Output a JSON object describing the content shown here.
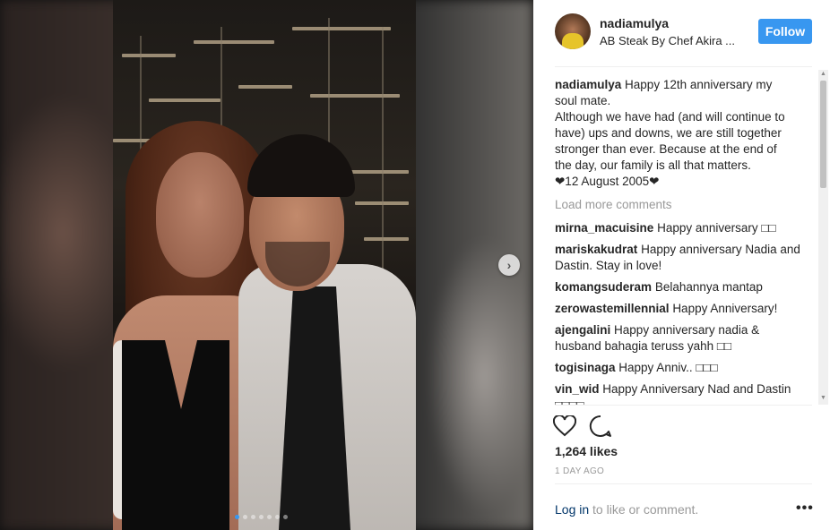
{
  "post": {
    "username": "nadiamulya",
    "location": "AB Steak By Chef Akira ...",
    "follow_label": "Follow",
    "caption_user": "nadiamulya",
    "caption_lines": [
      "Happy 12th anniversary my",
      "soul mate.",
      "Although we have had (and will continue to",
      "have) ups and downs, we are still together",
      "stronger than ever. Because at the end of",
      "the day, our family is all that matters.",
      "❤12 August 2005❤"
    ],
    "load_more": "Load more comments",
    "comments": [
      {
        "user": "mirna_macuisine",
        "text": "Happy anniversary □□"
      },
      {
        "user": "mariskakudrat",
        "text": "Happy anniversary Nadia and Dastin. Stay in love!"
      },
      {
        "user": "komangsuderam",
        "text": "Belahannya mantap"
      },
      {
        "user": "zerowastemillennial",
        "text": "Happy Anniversary!"
      },
      {
        "user": "ajengalini",
        "text": "Happy anniversary nadia & husband bahagia teruss yahh □□"
      },
      {
        "user": "togisinaga",
        "text": "Happy Anniv.. □□□"
      },
      {
        "user": "vin_wid",
        "text": "Happy Anniversary Nad and Dastin □□□□"
      }
    ],
    "likes": "1,264 likes",
    "time": "1 DAY AGO",
    "login_link": "Log in",
    "login_rest": " to like or comment.",
    "more_label": "•••"
  },
  "carousel": {
    "count": 7,
    "active_index": 0,
    "next_label": "›"
  },
  "colors": {
    "accent": "#3897f0",
    "link": "#003569",
    "muted": "#999999"
  },
  "icons": {
    "like": "heart-icon",
    "comment": "comment-icon",
    "next": "chevron-right-icon",
    "more": "more-options-icon"
  }
}
